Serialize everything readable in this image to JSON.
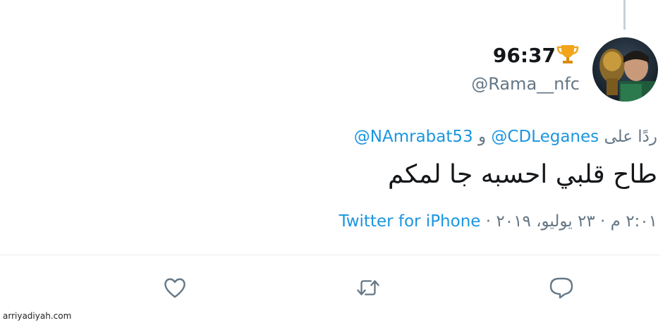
{
  "tweet": {
    "display_name": "96:37",
    "handle": "@Rama__nfc",
    "reply_prefix": "ردًا على",
    "reply_mention_1": "@CDLeganes",
    "reply_connector": "و",
    "reply_mention_2": "@NAmrabat53",
    "text": "طاح قلبي احسبه جا لمكم",
    "timestamp": "٢:٠١ م · ٢٣ يوليو، ٢٠١٩ ·",
    "source": "Twitter for iPhone"
  },
  "actions": {
    "like_icon": "heart-icon",
    "retweet_icon": "retweet-icon",
    "reply_icon": "reply-icon"
  },
  "watermark": "arriyadiyah.com",
  "colors": {
    "link": "#1b95e0",
    "muted": "#657786",
    "text": "#14171a"
  }
}
